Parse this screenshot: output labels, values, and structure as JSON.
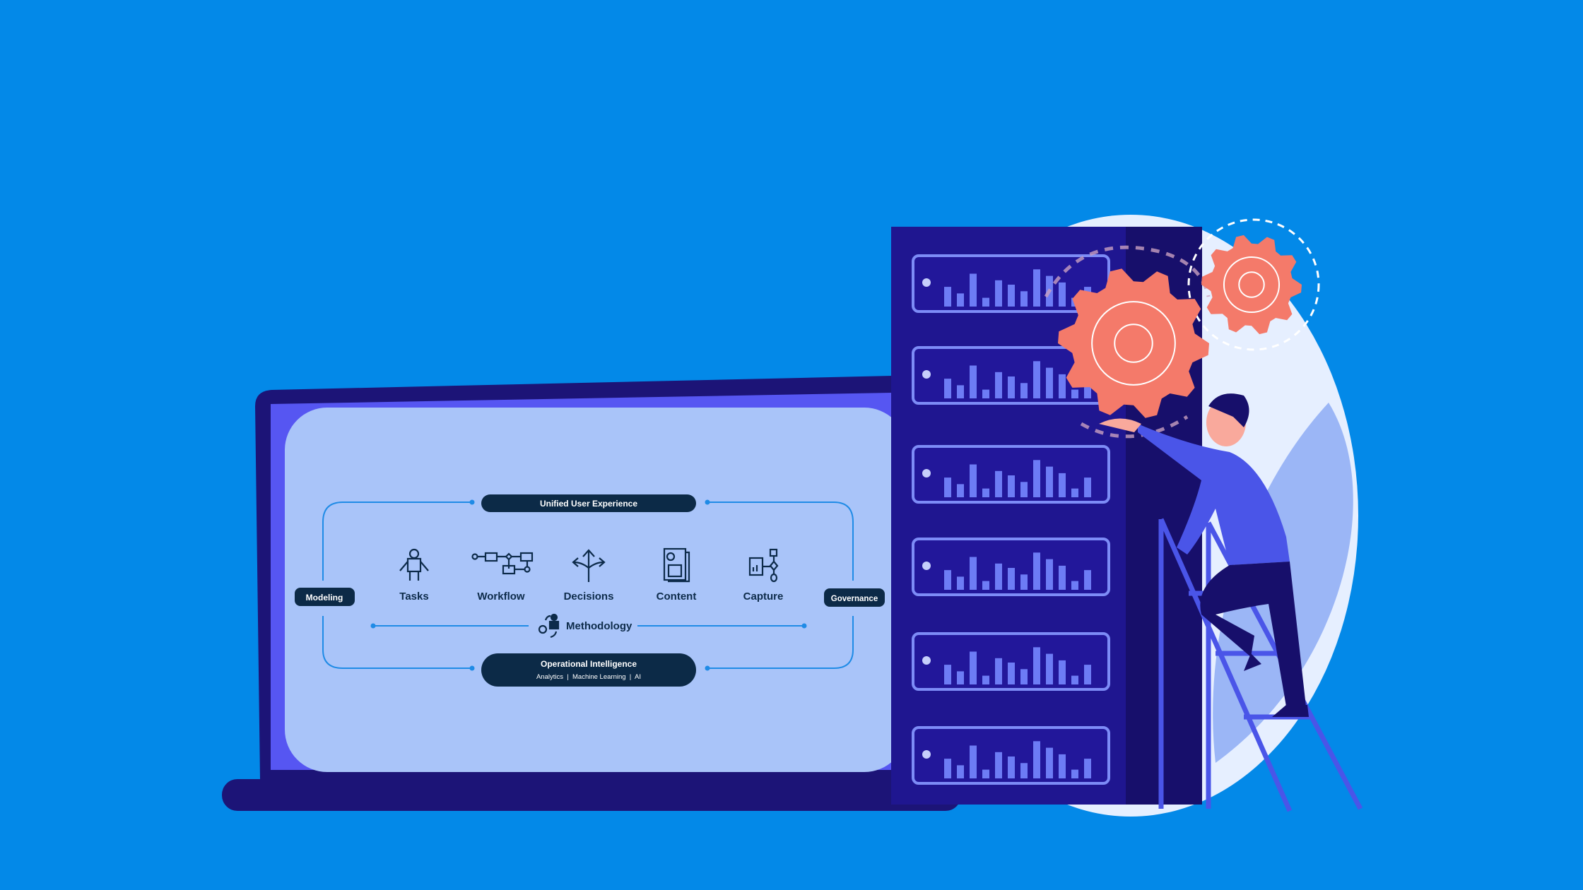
{
  "diagram": {
    "top_pill": "Unified User Experience",
    "left_pill": "Modeling",
    "right_pill": "Governance",
    "items": [
      {
        "label": "Tasks",
        "icon": "robot-icon"
      },
      {
        "label": "Workflow",
        "icon": "workflow-icon"
      },
      {
        "label": "Decisions",
        "icon": "split-arrows-icon"
      },
      {
        "label": "Content",
        "icon": "document-icon"
      },
      {
        "label": "Capture",
        "icon": "capture-icon"
      }
    ],
    "methodology": "Methodology",
    "bottom_pill": {
      "title": "Operational Intelligence",
      "subtitle": "Analytics  |  Machine Learning  |  AI"
    }
  },
  "colors": {
    "background": "#0389e8",
    "laptop_frame": "#1c1477",
    "screen_panel": "#a9c4f9",
    "pill": "#0c2a47",
    "server": "#1f1690",
    "gear": "#f47a6a",
    "bars": "#6d7cf5"
  }
}
